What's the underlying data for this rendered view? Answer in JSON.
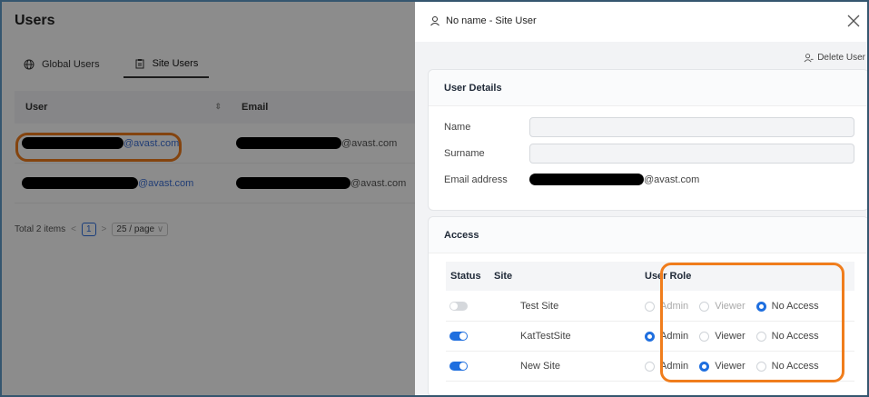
{
  "page": {
    "title": "Users",
    "tabs": [
      {
        "label": "Global Users",
        "icon": "globe-icon"
      },
      {
        "label": "Site Users",
        "icon": "clipboard-icon"
      }
    ],
    "table": {
      "headers": {
        "user": "User",
        "email": "Email"
      },
      "rows": [
        {
          "user_suffix": "@avast.com",
          "email_suffix": "@avast.com"
        },
        {
          "user_suffix": "@avast.com",
          "email_suffix": "@avast.com"
        }
      ]
    },
    "pager": {
      "total": "Total 2 items",
      "current_page": "1",
      "page_size": "25 / page"
    }
  },
  "drawer": {
    "title": "No name - Site User",
    "delete_label": "Delete User",
    "details": {
      "title": "User Details",
      "name_label": "Name",
      "surname_label": "Surname",
      "email_label": "Email address",
      "email_suffix": "@avast.com",
      "name_value": "",
      "surname_value": ""
    },
    "access": {
      "title": "Access",
      "headers": {
        "status": "Status",
        "site": "Site",
        "role": "User Role"
      },
      "role_options": [
        "Admin",
        "Viewer",
        "No Access"
      ],
      "rows": [
        {
          "site": "Test Site",
          "enabled": false,
          "role": "No Access"
        },
        {
          "site": "KatTestSite",
          "enabled": true,
          "role": "Admin"
        },
        {
          "site": "New Site",
          "enabled": true,
          "role": "Viewer"
        }
      ]
    }
  },
  "colors": {
    "accent": "#1f6fdf",
    "highlight": "#f07d1c",
    "link": "#3b6fd6"
  }
}
